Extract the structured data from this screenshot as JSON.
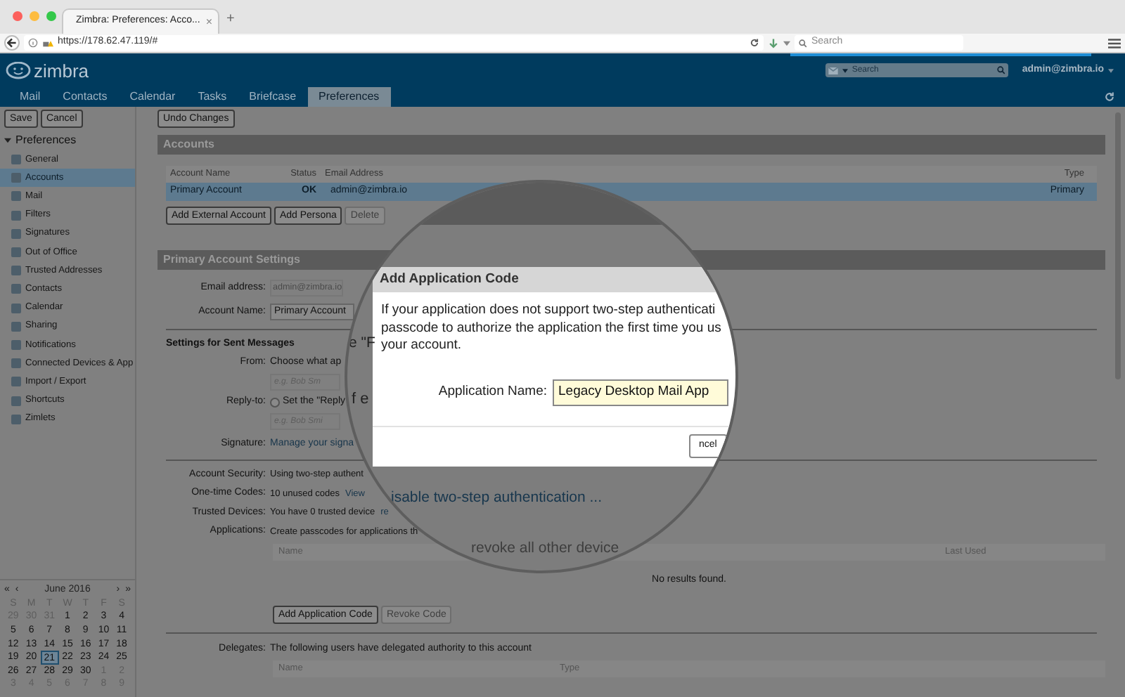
{
  "browser": {
    "tab_title": "Zimbra: Preferences: Acco...",
    "tab_close": "×",
    "new_tab": "+",
    "url": "https://178.62.47.119/#",
    "search_placeholder": "Search"
  },
  "app": {
    "logo": "zimbra",
    "search_placeholder": "Search",
    "user": "admin@zimbra.io",
    "tabs": [
      {
        "label": "Mail",
        "selected": false
      },
      {
        "label": "Contacts",
        "selected": false
      },
      {
        "label": "Calendar",
        "selected": false
      },
      {
        "label": "Tasks",
        "selected": false
      },
      {
        "label": "Briefcase",
        "selected": false
      },
      {
        "label": "Preferences",
        "selected": true
      }
    ]
  },
  "toolbar": {
    "left_buttons": [
      "Save",
      "Cancel"
    ],
    "undo": "Undo Changes"
  },
  "sidebar": {
    "title": "Preferences",
    "items": [
      {
        "label": "General",
        "selected": false
      },
      {
        "label": "Accounts",
        "selected": true
      },
      {
        "label": "Mail",
        "selected": false
      },
      {
        "label": "Filters",
        "selected": false
      },
      {
        "label": "Signatures",
        "selected": false
      },
      {
        "label": "Out of Office",
        "selected": false
      },
      {
        "label": "Trusted Addresses",
        "selected": false
      },
      {
        "label": "Contacts",
        "selected": false
      },
      {
        "label": "Calendar",
        "selected": false
      },
      {
        "label": "Sharing",
        "selected": false
      },
      {
        "label": "Notifications",
        "selected": false
      },
      {
        "label": "Connected Devices & App",
        "selected": false
      },
      {
        "label": "Import / Export",
        "selected": false
      },
      {
        "label": "Shortcuts",
        "selected": false
      },
      {
        "label": "Zimlets",
        "selected": false
      }
    ]
  },
  "calendar": {
    "month": "June 2016",
    "prev_year": "«",
    "prev": "‹",
    "next": "›",
    "next_year": "»",
    "weekdays": [
      "S",
      "M",
      "T",
      "W",
      "T",
      "F",
      "S"
    ],
    "weeks": [
      [
        {
          "day": "29",
          "kind": "other",
          "selected": false
        },
        {
          "day": "30",
          "kind": "other",
          "selected": false
        },
        {
          "day": "31",
          "kind": "other",
          "selected": false
        },
        {
          "day": "1",
          "kind": "current",
          "selected": false
        },
        {
          "day": "2",
          "kind": "current",
          "selected": false
        },
        {
          "day": "3",
          "kind": "current",
          "selected": false
        },
        {
          "day": "4",
          "kind": "current",
          "selected": false
        }
      ],
      [
        {
          "day": "5",
          "kind": "current",
          "selected": false
        },
        {
          "day": "6",
          "kind": "current",
          "selected": false
        },
        {
          "day": "7",
          "kind": "current",
          "selected": false
        },
        {
          "day": "8",
          "kind": "current",
          "selected": false
        },
        {
          "day": "9",
          "kind": "current",
          "selected": false
        },
        {
          "day": "10",
          "kind": "current",
          "selected": false
        },
        {
          "day": "11",
          "kind": "current",
          "selected": false
        }
      ],
      [
        {
          "day": "12",
          "kind": "current",
          "selected": false
        },
        {
          "day": "13",
          "kind": "current",
          "selected": false
        },
        {
          "day": "14",
          "kind": "current",
          "selected": false
        },
        {
          "day": "15",
          "kind": "current",
          "selected": false
        },
        {
          "day": "16",
          "kind": "current",
          "selected": false
        },
        {
          "day": "17",
          "kind": "current",
          "selected": false
        },
        {
          "day": "18",
          "kind": "current",
          "selected": false
        }
      ],
      [
        {
          "day": "19",
          "kind": "current",
          "selected": false
        },
        {
          "day": "20",
          "kind": "current",
          "selected": false
        },
        {
          "day": "21",
          "kind": "current",
          "selected": true
        },
        {
          "day": "22",
          "kind": "current",
          "selected": false
        },
        {
          "day": "23",
          "kind": "current",
          "selected": false
        },
        {
          "day": "24",
          "kind": "current",
          "selected": false
        },
        {
          "day": "25",
          "kind": "current",
          "selected": false
        }
      ],
      [
        {
          "day": "26",
          "kind": "current",
          "selected": false
        },
        {
          "day": "27",
          "kind": "current",
          "selected": false
        },
        {
          "day": "28",
          "kind": "current",
          "selected": false
        },
        {
          "day": "29",
          "kind": "current",
          "selected": false
        },
        {
          "day": "30",
          "kind": "current",
          "selected": false
        },
        {
          "day": "1",
          "kind": "other",
          "selected": false
        },
        {
          "day": "2",
          "kind": "other",
          "selected": false
        }
      ],
      [
        {
          "day": "3",
          "kind": "other",
          "selected": false
        },
        {
          "day": "4",
          "kind": "other",
          "selected": false
        },
        {
          "day": "5",
          "kind": "other",
          "selected": false
        },
        {
          "day": "6",
          "kind": "other",
          "selected": false
        },
        {
          "day": "7",
          "kind": "other",
          "selected": false
        },
        {
          "day": "8",
          "kind": "other",
          "selected": false
        },
        {
          "day": "9",
          "kind": "other",
          "selected": false
        }
      ]
    ]
  },
  "accounts": {
    "title": "Accounts",
    "columns": [
      "Account Name",
      "Status",
      "Email Address",
      "Type"
    ],
    "rows": [
      {
        "name": "Primary Account",
        "status": "OK",
        "email": "admin@zimbra.io",
        "type": "Primary",
        "selected": true
      }
    ],
    "buttons": [
      {
        "label": "Add External Account",
        "disabled": false
      },
      {
        "label": "Add Persona",
        "disabled": false
      },
      {
        "label": "Delete",
        "disabled": true
      }
    ]
  },
  "settings": {
    "title": "Primary Account Settings",
    "email_label": "Email address:",
    "email_value": "admin@zimbra.io",
    "name_label": "Account Name:",
    "name_value": "Primary Account",
    "sent_title": "Settings for Sent Messages",
    "from_label": "From:",
    "from_text": "Choose what ap",
    "from_placeholder": "e.g. Bob Sm",
    "reply_label": "Reply-to:",
    "reply_text": "Set the \"Reply",
    "reply_checked": false,
    "reply_placeholder": "e.g. Bob Smi",
    "signature_label": "Signature:",
    "signature_link": "Manage your signa"
  },
  "security": {
    "rows": [
      {
        "label": "Account Security:",
        "text": "Using two-step authent"
      },
      {
        "label": "One-time Codes:",
        "text": "10 unused codes",
        "link": "View"
      },
      {
        "label": "Trusted Devices:",
        "text": "You have 0 trusted device",
        "link": "re"
      },
      {
        "label": "Applications:",
        "text": "Create passcodes for applications th"
      }
    ],
    "app_columns": [
      "Name",
      "Last Used"
    ],
    "empty": "No results found.",
    "buttons": [
      {
        "label": "Add Application Code",
        "disabled": false
      },
      {
        "label": "Revoke Code",
        "disabled": true
      }
    ]
  },
  "delegates": {
    "label": "Delegates:",
    "text": "The following users have delegated authority to this account",
    "columns": [
      "Name",
      "Type"
    ]
  },
  "magnifier": {
    "dialog_title": "Add Application Code",
    "message": [
      "If your application does not support two-step authenticati",
      "passcode to authorize the application the first time you us",
      "your account."
    ],
    "field_label": "Application Name:",
    "field_value": "Legacy Desktop Mail App",
    "cancel": "ncel",
    "fragments": [
      "e \"F",
      "f e"
    ],
    "disable_link": "isable two-step authentication ...",
    "revoke_link": "revoke all other device"
  }
}
